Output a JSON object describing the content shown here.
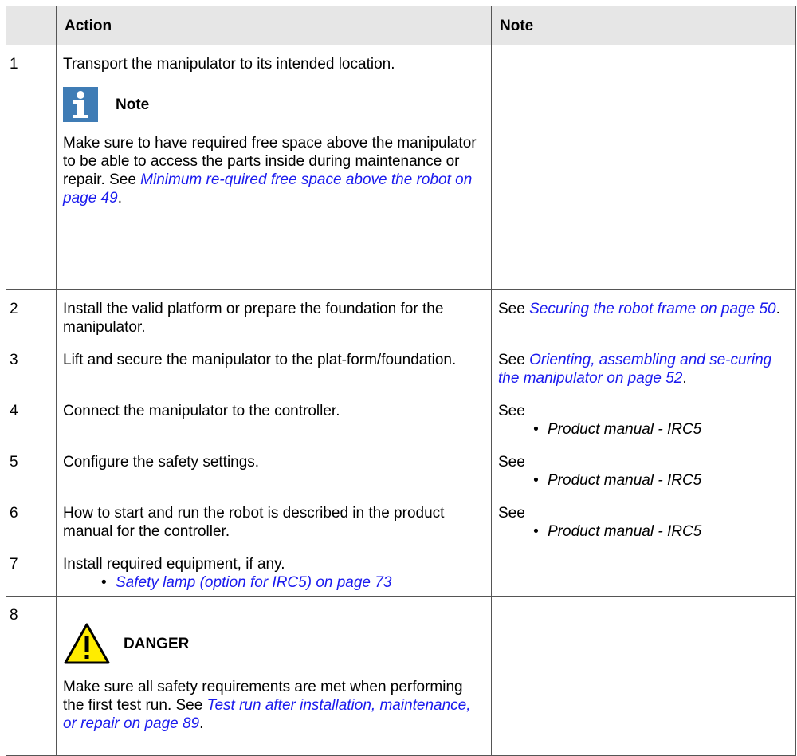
{
  "table": {
    "headers": {
      "blank": "",
      "action": "Action",
      "note": "Note"
    },
    "rows": [
      {
        "num": "1",
        "action": "Transport the manipulator to its intended location.",
        "note_label": "Note",
        "note_text": "Make sure to have required free space above the manipulator to be able to access the parts inside during maintenance or repair. See ",
        "note_link": "Minimum re-quired free space above the robot on page 49",
        "note_end": "."
      },
      {
        "num": "2",
        "action": "Install the valid platform or prepare the foundation for the manipulator.",
        "note_pre": "See ",
        "note_link": "Securing the robot frame on page 50",
        "note_end": "."
      },
      {
        "num": "3",
        "action": "Lift and secure the manipulator to the plat-form/foundation.",
        "note_pre": "See ",
        "note_link": "Orienting, assembling and se-curing the manipulator on page 52",
        "note_end": "."
      },
      {
        "num": "4",
        "action": "Connect the manipulator to the controller.",
        "note_pre": "See",
        "note_bullet": "Product manual - IRC5"
      },
      {
        "num": "5",
        "action": "Configure the safety settings.",
        "note_pre": "See",
        "note_bullet": "Product manual - IRC5"
      },
      {
        "num": "6",
        "action": "How to start and run the robot is described in the product manual for the controller.",
        "note_pre": "See",
        "note_bullet": "Product manual - IRC5"
      },
      {
        "num": "7",
        "action": "Install required equipment, if any.",
        "action_bullet": "Safety lamp (option for IRC5) on page 73"
      },
      {
        "num": "8",
        "danger_label": "DANGER",
        "danger_text": "Make sure all safety requirements are met when performing the first test run. See ",
        "danger_link": "Test run after installation, maintenance, or repair on page 89",
        "danger_end": "."
      }
    ]
  },
  "colors": {
    "link": "#1a1aee",
    "header_bg": "#e6e6e6",
    "note_icon": "#3f7cb5",
    "danger_icon": "#ffec00"
  },
  "icons": {
    "note": "info-icon",
    "danger": "warning-triangle-icon"
  }
}
